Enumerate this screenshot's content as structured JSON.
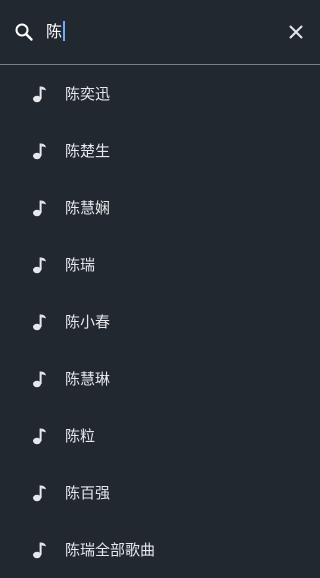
{
  "search": {
    "query": "陈",
    "icon": "search-icon"
  },
  "close": {
    "icon": "close-icon"
  },
  "suggestions": [
    {
      "label": "陈奕迅",
      "icon": "music-note-icon"
    },
    {
      "label": "陈楚生",
      "icon": "music-note-icon"
    },
    {
      "label": "陈慧娴",
      "icon": "music-note-icon"
    },
    {
      "label": "陈瑞",
      "icon": "music-note-icon"
    },
    {
      "label": "陈小春",
      "icon": "music-note-icon"
    },
    {
      "label": "陈慧琳",
      "icon": "music-note-icon"
    },
    {
      "label": "陈粒",
      "icon": "music-note-icon"
    },
    {
      "label": "陈百强",
      "icon": "music-note-icon"
    },
    {
      "label": "陈瑞全部歌曲",
      "icon": "music-note-icon"
    }
  ],
  "colors": {
    "background": "#222830",
    "text": "#e6e8eb",
    "caret": "#6fa8ff",
    "divider": "#7a8088"
  }
}
